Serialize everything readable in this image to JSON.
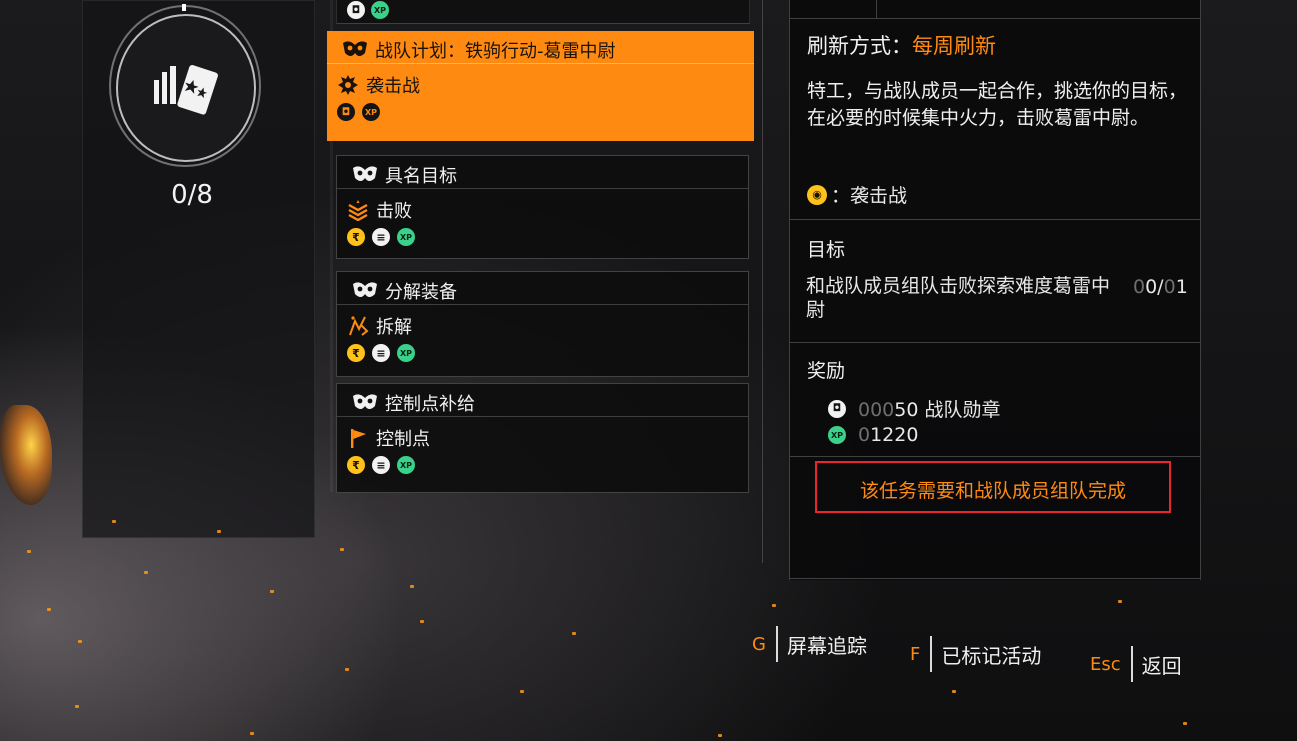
{
  "progress": {
    "count": "0/8"
  },
  "missions": [
    {
      "title": "战队计划：铁驹行动-葛雷中尉",
      "type": "袭击战",
      "rewards": [
        "clan",
        "xp"
      ],
      "active": true
    },
    {
      "title": "具名目标",
      "type": "击败",
      "rewards": [
        "credit",
        "gear",
        "xp"
      ],
      "active": false
    },
    {
      "title": "分解装备",
      "type": "拆解",
      "rewards": [
        "credit",
        "gear",
        "xp"
      ],
      "active": false
    },
    {
      "title": "控制点补给",
      "type": "控制点",
      "rewards": [
        "credit",
        "gear",
        "xp"
      ],
      "active": false
    }
  ],
  "detail": {
    "refresh_label": "刷新方式：",
    "refresh_value": "每周刷新",
    "description": "特工，与战队成员一起合作，挑选你的目标，在必要的时候集中火力，击败葛雷中尉。",
    "mode_label": "：袭击战",
    "objective_title": "目标",
    "objective_text": "和战队成员组队击败探索难度葛雷中尉",
    "objective_count_dim": "0",
    "objective_count_mid": "0/",
    "objective_count_dim2": "0",
    "objective_count_end": "1",
    "reward_title": "奖励",
    "reward_clan_dim": "000",
    "reward_clan_value": "50 战队勋章",
    "reward_xp_dim": "0",
    "reward_xp_value": "1220",
    "warning": "该任务需要和战队成员组队完成"
  },
  "hints": [
    {
      "key": "G",
      "label": "屏幕追踪"
    },
    {
      "key": "F",
      "label": "已标记活动"
    },
    {
      "key": "Esc",
      "label": "返回"
    }
  ],
  "reward_icon_text": {
    "clan": "◘",
    "xp": "XP",
    "credit": "₹",
    "gear": "≡"
  },
  "colors": {
    "accent": "#ff8a12",
    "warning_border": "#e8262b",
    "xp": "#3ad28a",
    "credit": "#ffc21a"
  }
}
